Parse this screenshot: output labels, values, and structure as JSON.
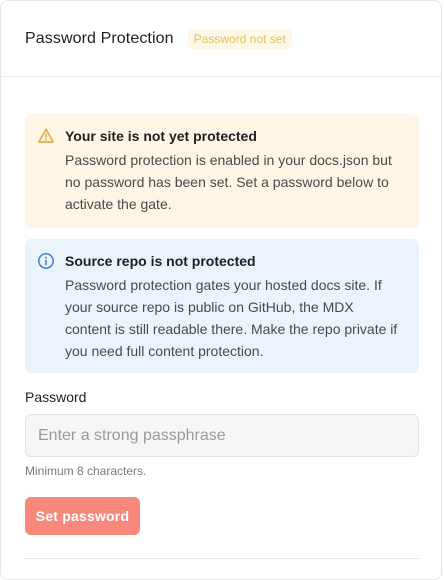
{
  "header": {
    "title": "Password Protection",
    "badge": "Password not set"
  },
  "warning": {
    "icon": "warning-triangle-icon",
    "title": "Your site is not yet protected",
    "text": "Password protection is enabled in your docs.json but no password has been set. Set a password below to activate the gate."
  },
  "info": {
    "icon": "info-circle-icon",
    "title": "Source repo is not protected",
    "text": "Password protection gates your hosted docs site. If your source repo is public on GitHub, the MDX content is still readable there. Make the repo private if you need full content protection."
  },
  "form": {
    "label": "Password",
    "value": "",
    "placeholder": "Enter a strong passphrase",
    "hint": "Minimum 8 characters.",
    "submit_label": "Set password"
  },
  "colors": {
    "badge_text": "#e8c25a",
    "badge_bg": "#fdf8e8",
    "warning_bg": "#fdf6e6",
    "warning_icon": "#e0a93a",
    "info_bg": "#ebf3fd",
    "info_icon": "#3f7fd6",
    "button_bg": "#f9887c"
  }
}
